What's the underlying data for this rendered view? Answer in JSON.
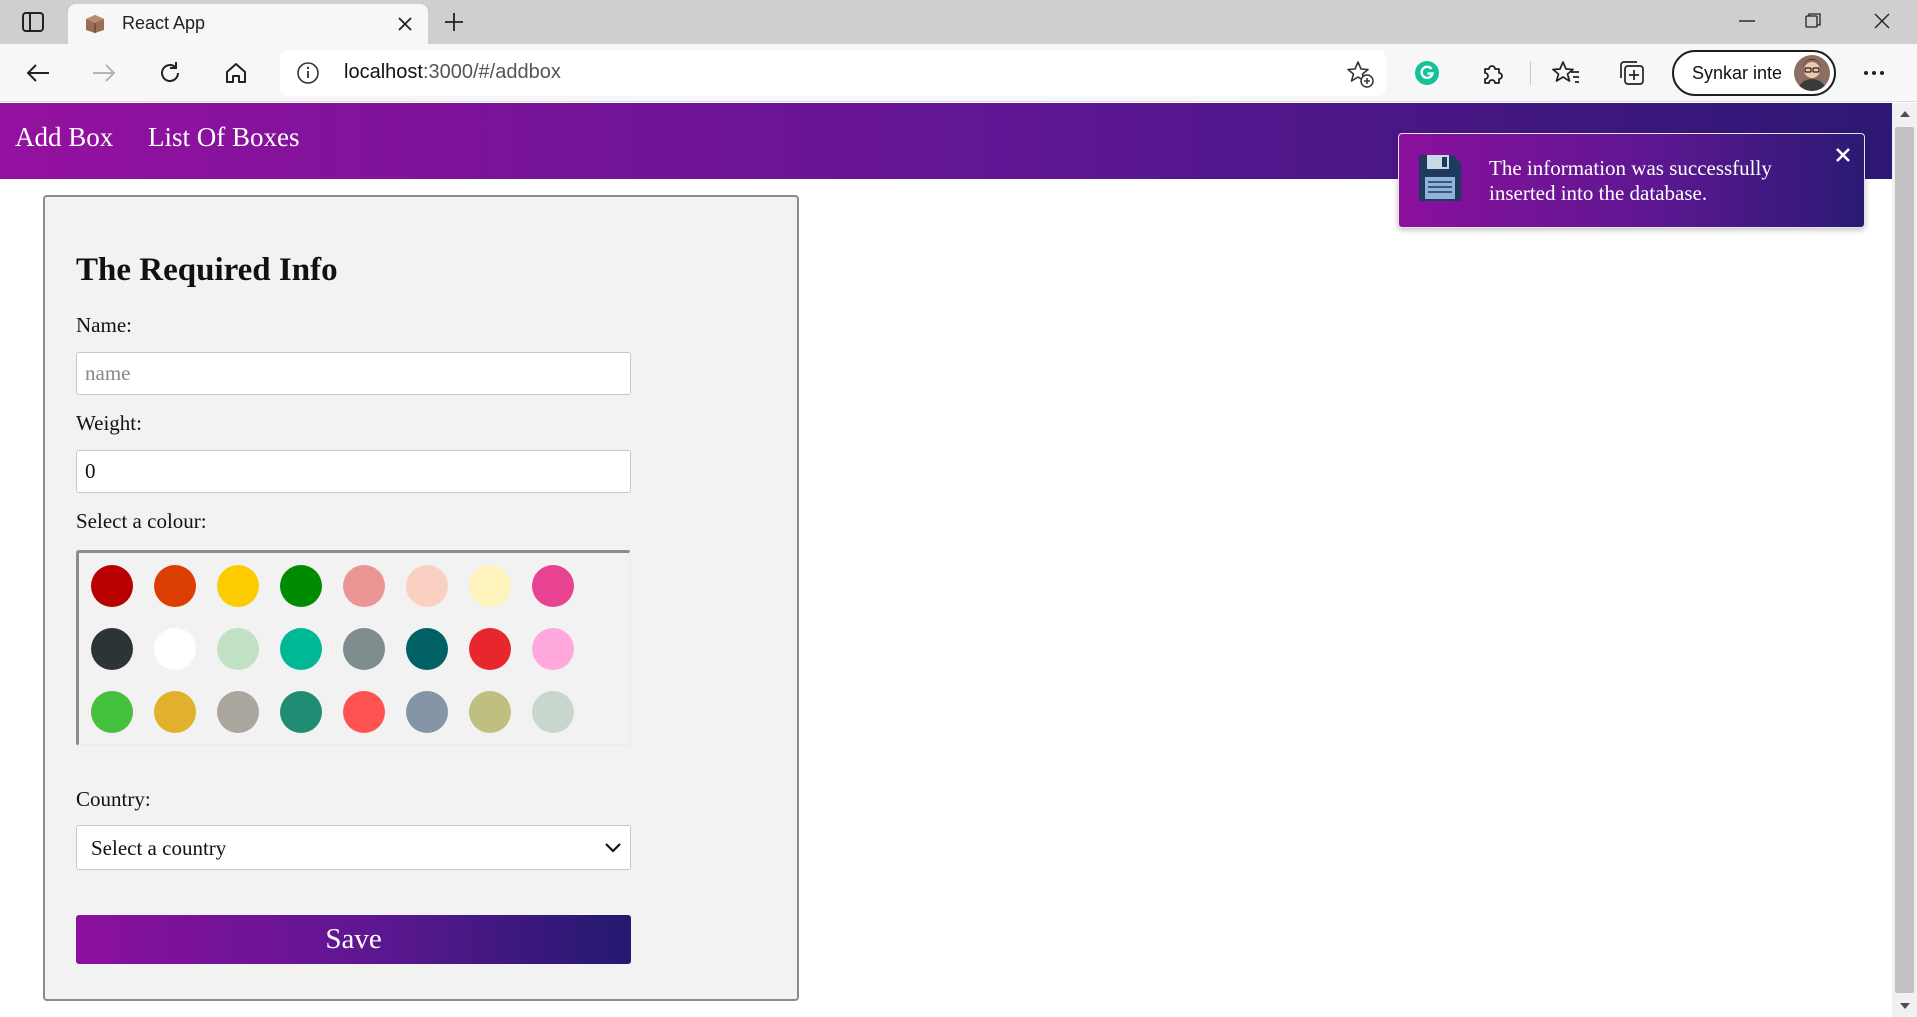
{
  "browser": {
    "tab_title": "React App",
    "url_host": "localhost",
    "url_rest": ":3000/#/addbox",
    "profile_label": "Synkar inte"
  },
  "nav": {
    "links": [
      "Add Box",
      "List Of Boxes"
    ]
  },
  "form": {
    "title": "The Required Info",
    "name_label": "Name:",
    "name_placeholder": "name",
    "name_value": "",
    "weight_label": "Weight:",
    "weight_value": "0",
    "colour_label": "Select a colour:",
    "colours": [
      "#b80000",
      "#db3e00",
      "#fccb00",
      "#008b02",
      "#eb9694",
      "#fad0c3",
      "#fef3bd",
      "#e84393",
      "#2d3436",
      "#ffffff",
      "#c1e1c5",
      "#00b894",
      "#7f8c8d",
      "#006064",
      "#e8262d",
      "#ffa8de",
      "#44c13c",
      "#e1b12c",
      "#aaa69d",
      "#218c74",
      "#ff5252",
      "#8395a7",
      "#bfc07f",
      "#c8d6cb"
    ],
    "country_label": "Country:",
    "country_selected": "Select a country",
    "save_label": "Save"
  },
  "toast": {
    "message": "The information was successfully inserted into the database."
  },
  "colors": {
    "brand_start": "#94119f",
    "brand_end": "#2d1874"
  }
}
